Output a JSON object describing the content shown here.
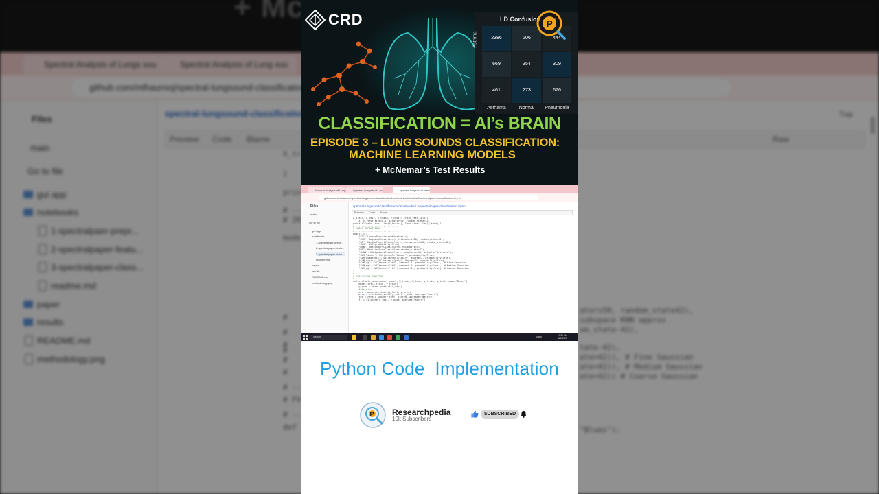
{
  "background": {
    "big_text": "+ Mc                               sults",
    "tabs": [
      "Spectral Analysis of Lungs sou",
      "Spectral Analysis of Lung sou"
    ],
    "url": "github.com/mlhaurooj/spectral-lungsound-classification/bl",
    "sidebar_title": "Files",
    "branch": "main",
    "go_to_file": "Go to file",
    "tree": [
      {
        "label": "gui app",
        "type": "folder"
      },
      {
        "label": "notebooks",
        "type": "folder"
      },
      {
        "label": "1-spectralpaer-prepr...",
        "type": "file"
      },
      {
        "label": "2-spectralpaper-featu...",
        "type": "file"
      },
      {
        "label": "3-spectralpaper-class...",
        "type": "file"
      },
      {
        "label": "readme.md",
        "type": "file"
      },
      {
        "label": "paper",
        "type": "folder"
      },
      {
        "label": "results",
        "type": "folder"
      },
      {
        "label": "README.md",
        "type": "file"
      },
      {
        "label": "methodology.png",
        "type": "file"
      }
    ],
    "crumb": "spectral-lungsound-classification / n",
    "view_tabs": [
      "Preview",
      "Code",
      "Blame"
    ],
    "right_labels": [
      "Raw",
      "Top"
    ],
    "code_left": [
      "X_tr",
      "}",
      "prin",
      "# --",
      "# 20",
      "mode",
      "#",
      "#",
      "#",
      "#",
      "#",
      "#",
      "# --",
      "# FV",
      "# --",
      "def"
    ],
    "code_right": [
      "ators50, random_state42),",
      "subspace KNN approx",
      "om_state-42),",
      "tate-42),",
      "ate=42)),  # Fine Gaussian",
      "ate=42)),  # Medium Gaussian",
      "ate=42))  # Coarse Gaussian",
      "\"Blues\"):"
    ]
  },
  "thumbnail": {
    "brand": "CRD",
    "confusion_matrix": {
      "title": "LD Confusion ...ate",
      "row_label": "Asthma",
      "cells": [
        [
          2386,
          206,
          444
        ],
        [
          669,
          354,
          309
        ],
        [
          461,
          273,
          676
        ]
      ],
      "x_labels": [
        "Asthama",
        "Normal",
        "Pneumonia"
      ],
      "cell_colors": [
        "#0f2a3a",
        "#1f2a30",
        "#1a2226"
      ]
    },
    "headline": "CLASSIFICATION = AI’s BRAIN",
    "episode_line1": "EPISODE 3 – LUNG SOUNDS CLASSIFICATION:",
    "episode_line2": "MACHINE LEARNING MODELS",
    "subline": "+ McNemar’s Test Results",
    "colors": {
      "headline": "#8fd44a",
      "episode": "#f2c12e",
      "lungs": "#2ec4c4"
    }
  },
  "mini_screen": {
    "tabs": [
      "Spectral Analysis of Lungs sou",
      "Spectral Analysis of Lung sou",
      "spectral-lungsound-classificatio"
    ],
    "url": "github.com/mlhaurooj/spectral-lungsound-classification/blob/main/notebooks/3-spectralpaper-classification.ipynb",
    "files_title": "Files",
    "branch": "main",
    "go_to_file": "Go to file",
    "tree": [
      "gui app",
      "notebooks",
      "1-spectralpaer-prepr...",
      "2-spectralpaper-featu...",
      "3-spectralpaper-class...",
      "readme.md",
      "paper",
      "results",
      "README.md",
      "methodology.png"
    ],
    "crumb": "spectral-lungsound-classification / notebooks / 3-spectralpaper-classification.ipynb",
    "view_tabs": [
      "Preview",
      "Code",
      "Blame"
    ],
    "code_lines": [
      "X_train, X_test, y_train, y_test = train_test_split(",
      "    X, y, test_size=0.2, stratify=y, random_state=42)",
      "",
      "print(f\"Train size: {len(X_train)}, Test size: {len(X_test)}\")",
      "",
      "# -----------------------------",
      "# MODEL DEFINITIONS",
      "# -----------------------------",
      "models = {",
      "    \"LD\": LinearDiscriminantAnalysis(),",
      "    \"ENS\": BaggingClassifier(n_estimators=50, random_state=42),",
      "    \"RF\": RandomForestClassifier(n_estimators=100, random_state=42),",
      "    \"SVM\": SVC(probability=True),",
      "    \"KNN\": KNeighborsClassifier(n_neighbors=5),",
      "    \"DT\": DecisionTreeClassifier(random_state=42),",
      "    \"SKNN\": KNeighborsClassifier(n_neighbors=10, weights=\"distance\"),",
      "    \"SVM_linear\": SVC(kernel=\"linear\", probability=True),",
      "    \"SVM_quadratic\": SVC(kernel=\"poly\", degree=2, probability=True),",
      "    \"SVM_cubic\": SVC(kernel=\"poly\", degree=3, probability=True),",
      "    \"SVM_fg\": SVC(kernel=\"rbf\", gamma=0.5, probability=True),  # Fine Gaussian",
      "    \"SVM_mg\": SVC(kernel=\"rbf\", gamma=0.1, probability=True),  # Medium Gaussian",
      "    \"SVM_cg\": SVC(kernel=\"rbf\", gamma=0.01, probability=True)  # Coarse Gaussian",
      "}",
      "",
      "# -----------------------------",
      "# EVALUATION FUNCTION",
      "# -----------------------------",
      "def evaluate_model(name, model, X_train, X_test, y_train, y_test, cmap=\"Blues\"):",
      "    model.fit(X_train, y_train)",
      "    y_pred = model.predict(X_test)",
      "",
      "    # Metrics",
      "    acc = accuracy_score(y_test, y_pred)",
      "    prec = precision_score(y_test, y_pred, average=\"macro\")",
      "    rec = recall_score(y_test, y_pred, average=\"macro\")",
      "    f1 = f1_score(y_test, y_pred, average=\"macro\")"
    ],
    "taskbar": {
      "search": "Search",
      "weather": "Match",
      "time": "11:54 AM",
      "date": "8/5/2025"
    }
  },
  "heading": "Python Code  Implementation",
  "channel": {
    "name": "Researchpedia",
    "subscribers": "10k Subscribers",
    "subscribe_label": "SUBSCRIBED"
  }
}
